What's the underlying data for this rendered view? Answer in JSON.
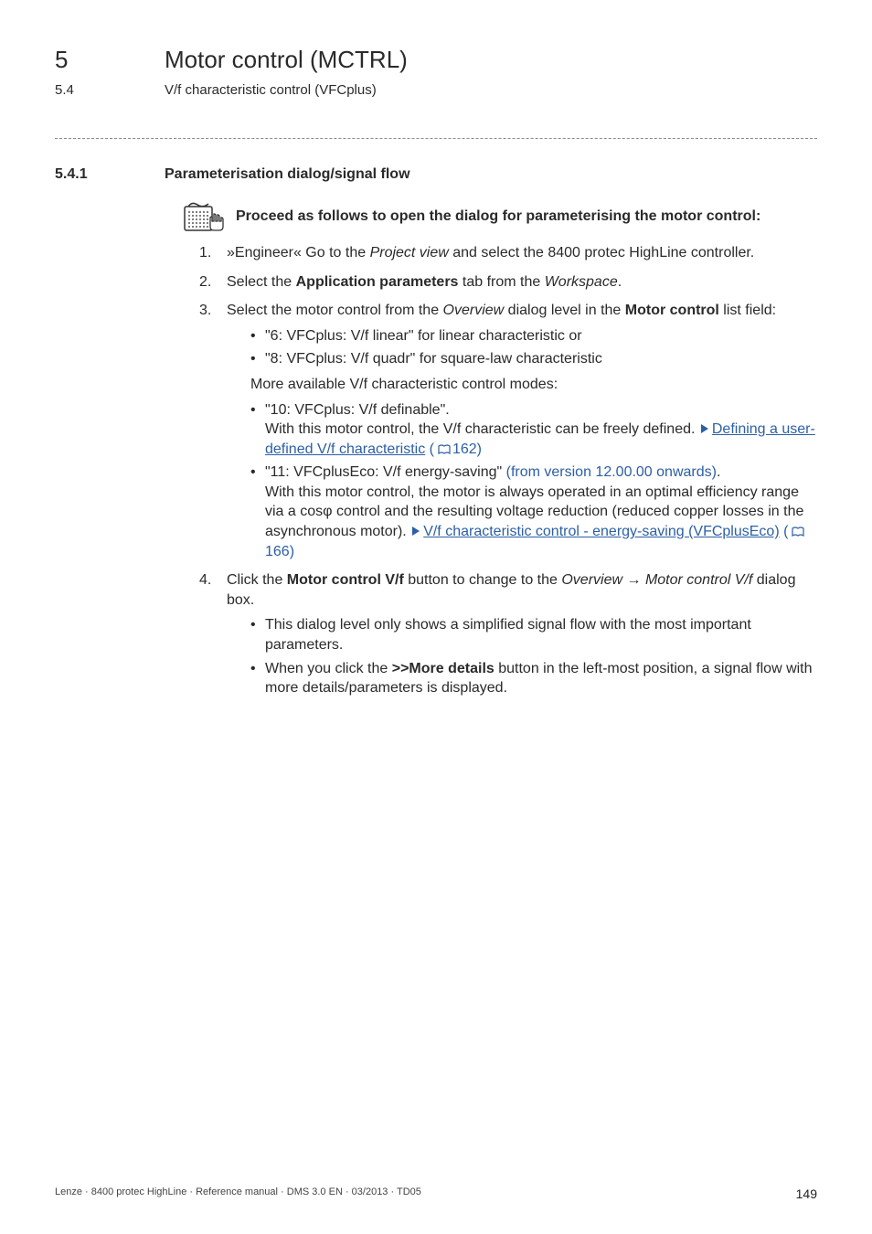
{
  "header": {
    "chapter_num": "5",
    "chapter_title": "Motor control (MCTRL)",
    "section_num": "5.4",
    "section_title": "V/f characteristic control (VFCplus)"
  },
  "subsection": {
    "num": "5.4.1",
    "title": "Parameterisation dialog/signal flow"
  },
  "proceed": {
    "text": "Proceed as follows to open the dialog for parameterising the motor control:"
  },
  "steps": {
    "s1_num": "1.",
    "s1_a": "»Engineer« Go to the ",
    "s1_i": "Project view",
    "s1_b": " and select the 8400 protec HighLine controller.",
    "s2_num": "2.",
    "s2_a": "Select the ",
    "s2_bold": "Application parameters",
    "s2_b": " tab from the ",
    "s2_i": "Workspace",
    "s2_c": ".",
    "s3_num": "3.",
    "s3_a": "Select the motor control from the ",
    "s3_i1": "Overview",
    "s3_b": " dialog level in the ",
    "s3_bold": "Motor control",
    "s3_c": " list field:",
    "s3_b1": "\"6: VFCplus: V/f linear\" for linear characteristic or",
    "s3_b2": "\"8: VFCplus: V/f quadr\" for square-law characteristic",
    "s3_more": "More available V/f characteristic control modes:",
    "s3_b3_head": "\"10: VFCplus: V/f definable\".",
    "s3_b3_line2a": "With this motor control, the V/f characteristic can be freely defined.  ",
    "s3_b3_link": "Defining a user-defined V/f characteristic",
    "s3_b3_pgref": "162)",
    "s3_b4_head_a": "\"11: VFCplusEco: V/f energy-saving\" ",
    "s3_b4_head_blue": "(from version 12.00.00 onwards)",
    "s3_b4_head_b": ".",
    "s3_b4_line2": "With this motor control, the motor is always operated in an optimal efficiency range via a cosφ control and the resulting voltage reduction (reduced copper losses in the asynchronous motor).  ",
    "s3_b4_link": "V/f characteristic control - energy-saving (VFCplusEco)",
    "s3_b4_pgref": "166)",
    "s4_num": "4.",
    "s4_a": "Click the ",
    "s4_bold": "Motor control V/f",
    "s4_b": " button to change to the ",
    "s4_i1": "Overview",
    "s4_arrow": " → ",
    "s4_i2": "Motor control V/f",
    "s4_c": " dialog box.",
    "s4_b1": "This dialog level only shows a simplified signal flow with the most important parameters.",
    "s4_b2_a": "When you click the ",
    "s4_b2_bold": ">>More details",
    "s4_b2_b": " button in the left-most position, a signal flow with more details/parameters is displayed."
  },
  "footer": {
    "left": "Lenze · 8400 protec HighLine · Reference manual · DMS 3.0 EN · 03/2013 · TD05",
    "page": "149"
  }
}
